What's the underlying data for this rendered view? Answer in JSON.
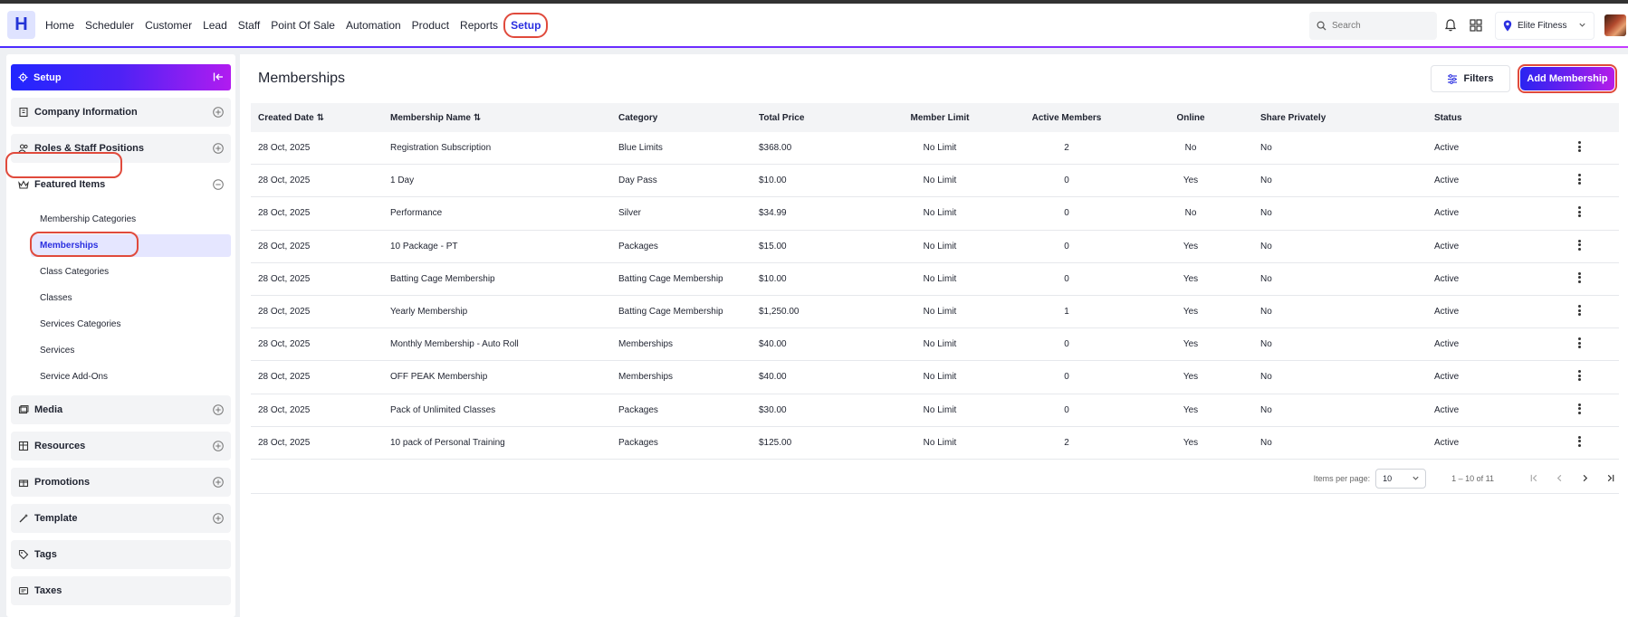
{
  "nav": {
    "logo": "H",
    "items": [
      "Home",
      "Scheduler",
      "Customer",
      "Lead",
      "Staff",
      "Point Of Sale",
      "Automation",
      "Product",
      "Reports"
    ],
    "active": "Setup",
    "search_placeholder": "Search",
    "location": "Elite Fitness",
    "icons": [
      "bell-icon",
      "grid-icon",
      "map-pin-icon"
    ]
  },
  "sidebar": {
    "header": "Setup",
    "sections_top": [
      "Company Information",
      "Roles & Staff Positions"
    ],
    "featured": "Featured Items",
    "sub_items": [
      "Membership Categories",
      "Memberships",
      "Class Categories",
      "Classes",
      "Services Categories",
      "Services",
      "Service Add-Ons"
    ],
    "active_sub": "Memberships",
    "sections_bottom": [
      "Media",
      "Resources",
      "Promotions",
      "Template",
      "Tags",
      "Taxes"
    ]
  },
  "main": {
    "title": "Memberships",
    "filters_label": "Filters",
    "add_label": "Add Membership",
    "columns": [
      "Created Date",
      "Membership Name",
      "Category",
      "Total Price",
      "Member Limit",
      "Active Members",
      "Online",
      "Share Privately",
      "Status"
    ],
    "rows": [
      [
        "28 Oct, 2025",
        "Registration Subscription",
        "Blue Limits",
        "$368.00",
        "No Limit",
        "2",
        "No",
        "No",
        "Active"
      ],
      [
        "28 Oct, 2025",
        "1 Day",
        "Day Pass",
        "$10.00",
        "No Limit",
        "0",
        "Yes",
        "No",
        "Active"
      ],
      [
        "28 Oct, 2025",
        "Performance",
        "Silver",
        "$34.99",
        "No Limit",
        "0",
        "No",
        "No",
        "Active"
      ],
      [
        "28 Oct, 2025",
        "10 Package - PT",
        "Packages",
        "$15.00",
        "No Limit",
        "0",
        "Yes",
        "No",
        "Active"
      ],
      [
        "28 Oct, 2025",
        "Batting Cage Membership",
        "Batting Cage Membership",
        "$10.00",
        "No Limit",
        "0",
        "Yes",
        "No",
        "Active"
      ],
      [
        "28 Oct, 2025",
        "Yearly Membership",
        "Batting Cage Membership",
        "$1,250.00",
        "No Limit",
        "1",
        "Yes",
        "No",
        "Active"
      ],
      [
        "28 Oct, 2025",
        "Monthly Membership - Auto Roll",
        "Memberships",
        "$40.00",
        "No Limit",
        "0",
        "Yes",
        "No",
        "Active"
      ],
      [
        "28 Oct, 2025",
        "OFF PEAK Membership",
        "Memberships",
        "$40.00",
        "No Limit",
        "0",
        "Yes",
        "No",
        "Active"
      ],
      [
        "28 Oct, 2025",
        "Pack of Unlimited Classes",
        "Packages",
        "$30.00",
        "No Limit",
        "0",
        "Yes",
        "No",
        "Active"
      ],
      [
        "28 Oct, 2025",
        "10 pack of Personal Training",
        "Packages",
        "$125.00",
        "No Limit",
        "2",
        "Yes",
        "No",
        "Active"
      ]
    ],
    "pagination": {
      "items_per_page_label": "Items per page:",
      "items_per_page": "10",
      "range": "1 – 10 of 11"
    }
  },
  "colors": {
    "accent": "#2a2fe0",
    "highlight": "#e04a3c"
  }
}
